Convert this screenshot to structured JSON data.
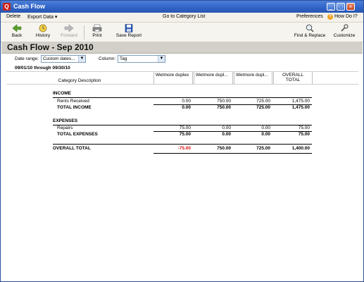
{
  "window": {
    "title": "Cash Flow"
  },
  "menu": {
    "delete": "Delete",
    "export_data": "Export Data ▾",
    "go_to": "Go to Category List",
    "preferences": "Preferences",
    "how_do_i": "How Do I?"
  },
  "toolbar": {
    "back": "Back",
    "history": "History",
    "forward": "Forward",
    "print": "Print",
    "save_report": "Save Report",
    "find_replace": "Find & Replace",
    "customize": "Customize"
  },
  "report": {
    "title": "Cash Flow - Sep 2010",
    "date_range_label": "Date range:",
    "date_range_value": "Custom dates...",
    "column_label": "Column:",
    "column_value": "Tag",
    "period": "09/01/10 through 09/30/10"
  },
  "columns": {
    "category": "Category Description",
    "c1": "Wetmore duplex",
    "c2": "Wetmore dupl...",
    "c3": "Wetmore dupl...",
    "total_1": "OVERALL",
    "total_2": "TOTAL"
  },
  "rows": {
    "income_header": "INCOME",
    "rents": {
      "label": "Rents Received",
      "c1": "0.00",
      "c2": "750.00",
      "c3": "725.00",
      "total": "1,475.00"
    },
    "total_income": {
      "label": "TOTAL INCOME",
      "c1": "0.00",
      "c2": "750.00",
      "c3": "725.00",
      "total": "1,475.00"
    },
    "expenses_header": "EXPENSES",
    "repairs": {
      "label": "Repairs",
      "c1": "75.00",
      "c2": "0.00",
      "c3": "0.00",
      "total": "75.00"
    },
    "total_expenses": {
      "label": "TOTAL EXPENSES",
      "c1": "75.00",
      "c2": "0.00",
      "c3": "0.00",
      "total": "75.00"
    },
    "overall": {
      "label": "OVERALL TOTAL",
      "c1": "-75.00",
      "c2": "750.00",
      "c3": "725.00",
      "total": "1,400.00"
    }
  },
  "colors": {
    "negative": "#d11111",
    "titlebar": "#2f63c5",
    "app_icon": "#c8231c"
  }
}
